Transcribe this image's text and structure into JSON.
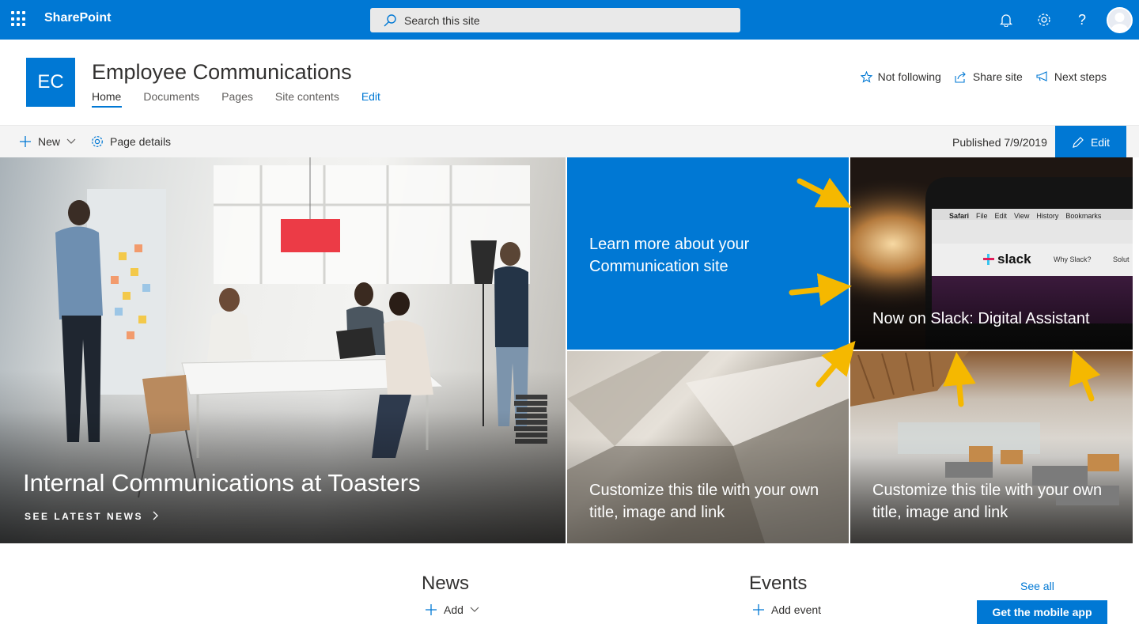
{
  "suite_bar": {
    "app_name": "SharePoint",
    "search_placeholder": "Search this site",
    "icons": [
      "waffle-icon",
      "search-icon",
      "bell-icon",
      "gear-icon",
      "help-icon",
      "avatar"
    ]
  },
  "site": {
    "logo_text": "EC",
    "title": "Employee Communications",
    "nav": [
      {
        "label": "Home"
      },
      {
        "label": "Documents"
      },
      {
        "label": "Pages"
      },
      {
        "label": "Site contents"
      },
      {
        "label": "Edit"
      }
    ],
    "actions": {
      "follow": "Not following",
      "share": "Share site",
      "next_steps": "Next steps"
    }
  },
  "command_bar": {
    "new_label": "New",
    "page_details_label": "Page details",
    "published": "Published 7/9/2019",
    "edit_label": "Edit"
  },
  "hero": {
    "main_title": "Internal Communications at Toasters",
    "main_link": "SEE LATEST NEWS",
    "tile_blue": "Learn more about your Communication site",
    "tile_slack": "Now on Slack: Digital Assistant",
    "tile_arch1": "Customize this tile with your own title, image and link",
    "tile_arch2": "Customize this tile with your own title, image and link",
    "slack_screen": {
      "menu": [
        "Safari",
        "File",
        "Edit",
        "View",
        "History",
        "Bookmarks"
      ],
      "logo": "slack",
      "nav1": "Why Slack?",
      "nav2": "Solut"
    }
  },
  "news": {
    "title": "News",
    "add_label": "Add"
  },
  "events": {
    "title": "Events",
    "add_label": "Add event",
    "see_all": "See all"
  },
  "mobile_button": "Get the mobile app",
  "colors": {
    "brand": "#0078d4",
    "arrow": "#f5b800"
  }
}
